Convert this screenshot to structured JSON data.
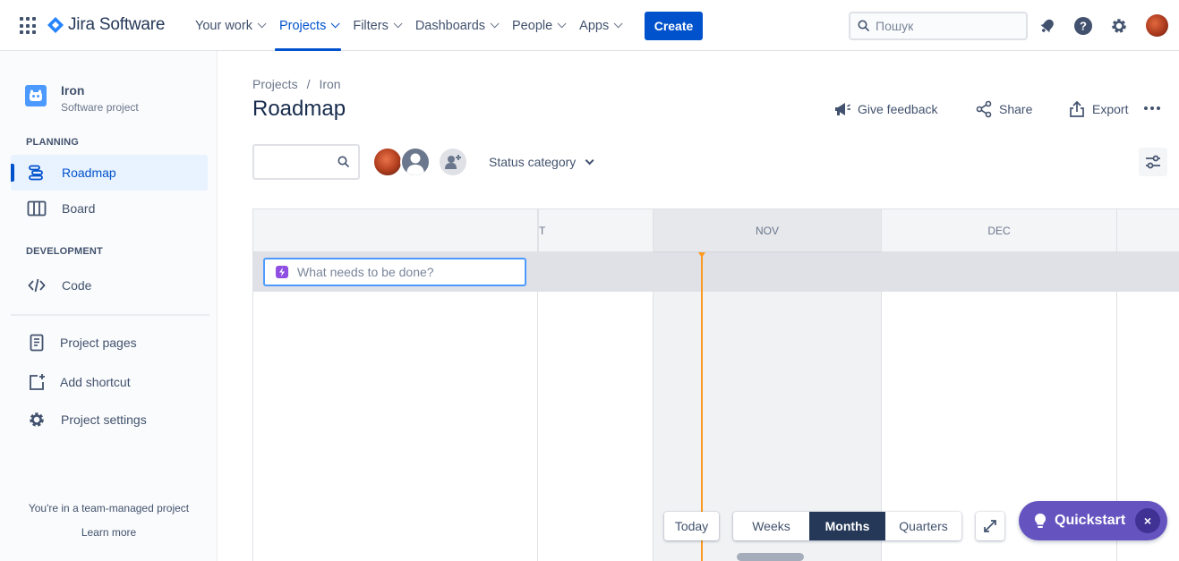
{
  "topnav": {
    "product_name": "Jira Software",
    "items": [
      {
        "label": "Your work"
      },
      {
        "label": "Projects"
      },
      {
        "label": "Filters"
      },
      {
        "label": "Dashboards"
      },
      {
        "label": "People"
      },
      {
        "label": "Apps"
      }
    ],
    "active_item": "Projects",
    "create_label": "Create",
    "search_placeholder": "Пошук",
    "icons": [
      "apps-grid-icon",
      "notification-bell-icon",
      "help-icon",
      "settings-gear-icon"
    ]
  },
  "sidebar": {
    "project_name": "Iron",
    "project_type": "Software project",
    "sections": {
      "planning": "PLANNING",
      "development": "DEVELOPMENT"
    },
    "planning_items": [
      {
        "label": "Roadmap",
        "icon": "roadmap-icon",
        "active": true
      },
      {
        "label": "Board",
        "icon": "board-icon"
      }
    ],
    "development_items": [
      {
        "label": "Code",
        "icon": "code-icon"
      }
    ],
    "other_items": [
      {
        "label": "Project pages",
        "icon": "page-icon"
      },
      {
        "label": "Add shortcut",
        "icon": "add-shortcut-icon"
      },
      {
        "label": "Project settings",
        "icon": "settings-gear-icon"
      }
    ],
    "footer_text": "You're in a team-managed project",
    "footer_link": "Learn more"
  },
  "header": {
    "breadcrumb": [
      "Projects",
      "Iron"
    ],
    "breadcrumb_sep": "/",
    "title": "Roadmap",
    "actions": {
      "feedback": "Give feedback",
      "share": "Share",
      "export": "Export"
    }
  },
  "filters": {
    "search_placeholder": "",
    "status_category": "Status category"
  },
  "timeline": {
    "months": [
      "T",
      "NOV",
      "DEC"
    ],
    "create_placeholder": "What needs to be done?",
    "accent_today": "#ff991f"
  },
  "controls": {
    "today": "Today",
    "views": [
      "Weeks",
      "Months",
      "Quarters"
    ],
    "selected_view": "Months",
    "quickstart": "Quickstart",
    "quickstart_close": "×"
  },
  "colors": {
    "brand": "#0052cc",
    "quickstart": "#6554c0",
    "selected_view": "#253858"
  }
}
